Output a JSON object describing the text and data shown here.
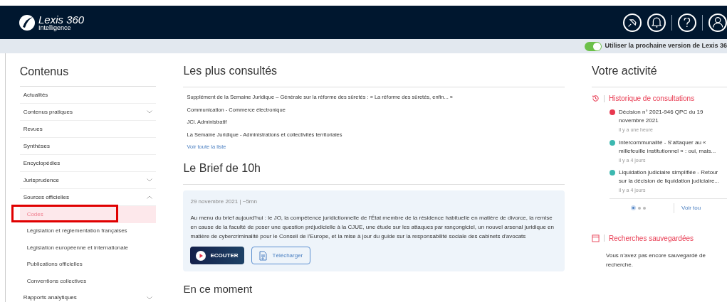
{
  "header": {
    "logo_name": "Lexis 360",
    "logo_sub": "Intelligence"
  },
  "toggle": {
    "on": true,
    "label": "Utiliser la prochaine version de Lexis 36"
  },
  "sidebar": {
    "title": "Contenus",
    "items": [
      {
        "label": "Actualités",
        "selected": false
      },
      {
        "label": "Contenus pratiques",
        "selected": false,
        "expanded": false
      },
      {
        "label": "Revues",
        "selected": false
      },
      {
        "label": "Synthèses",
        "selected": false
      },
      {
        "label": "Encyclopédies",
        "selected": false
      },
      {
        "label": "Jurisprudence",
        "selected": false,
        "expanded": false
      },
      {
        "label": "Sources officielles",
        "selected": false,
        "expanded": true,
        "children": [
          {
            "label": "Codes",
            "selected": true,
            "highlighted": true
          },
          {
            "label": "Législation et réglementation françaises",
            "selected": false,
            "highlighted": false
          },
          {
            "label": "Législation européenne et internationale",
            "selected": false,
            "highlighted": false
          },
          {
            "label": "Publications officielles",
            "selected": false,
            "highlighted": false
          },
          {
            "label": "Conventions collectives",
            "selected": false,
            "highlighted": false
          }
        ]
      },
      {
        "label": "Rapports analytiques",
        "selected": false,
        "expanded": false
      }
    ]
  },
  "most_viewed": {
    "title": "Les plus consultés",
    "items": [
      "Supplément de la Semaine Juridique – Générale sur la réforme des sûretés : « La réforme des sûretés, enfin... »",
      "Communication - Commerce électronique",
      "JCl. Administratif",
      "La Semaine Juridique - Administrations et collectivités territoriales"
    ],
    "link": "Voir toute la liste"
  },
  "brief": {
    "title": "Le Brief de 10h",
    "meta": "29 novembre 2021 | ~5mn",
    "text": "Au menu du brief aujourd'hui : le JO, la compétence juridictionnelle de l'État membre de la résidence habituelle en matière de divorce, la remise en cause de la faculté de poser une question préjudicielle à la CJUE, une étude sur les attaques par rançongiciel, un nouvel arsenal juridique en matière de cybercriminalité pour le Conseil de l'Europe, et la mise à jour du guide sur la responsabilité sociale des cabinets d'avocats",
    "listen": "ECOUTER",
    "download": "Télécharger"
  },
  "now": {
    "title": "En ce moment"
  },
  "activity": {
    "title": "Votre activité",
    "history_title": "Historique de consultations",
    "history": [
      {
        "title": "Décision n° 2021-946 QPC du 19 novembre 2021",
        "time": "il y a une heure",
        "color": "#e8384f"
      },
      {
        "title": "Intercommunalité - S'attaquer au « millefeuille institutionnel » : oui, mais...",
        "time": "il y a 4 jours",
        "color": "#3cb8b0"
      },
      {
        "title": "Liquidation judiciaire simplifiée - Retour sur la décision de liquidation judiciaire...",
        "time": "il y a 4 jours",
        "color": "#3cb8b0"
      }
    ],
    "pages": [
      {
        "selected": true
      },
      {
        "selected": false
      },
      {
        "selected": false
      }
    ],
    "see_all": "Voir tou",
    "saved_title": "Recherches sauvegardées",
    "saved_empty": "Vous n'avez pas encore sauvegardé de recherche."
  }
}
